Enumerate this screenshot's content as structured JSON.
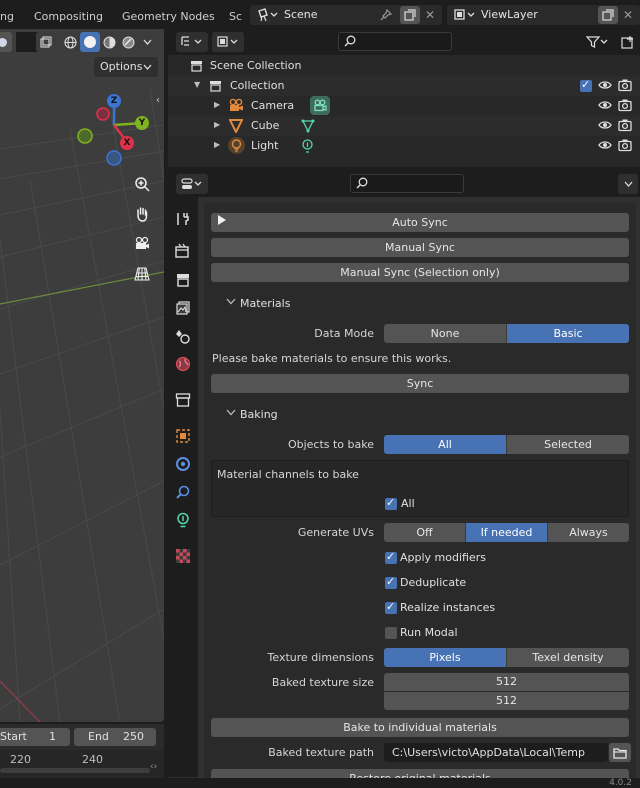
{
  "topbar": {
    "workspace_tabs": [
      "ng",
      "Compositing",
      "Geometry Nodes",
      "Sc"
    ],
    "scene_name": "Scene",
    "view_layer_name": "ViewLayer"
  },
  "viewport": {
    "options_label": "Options",
    "gizmo": {
      "z": "Z",
      "y": "Y",
      "x": "X"
    }
  },
  "timeline": {
    "start_label": "Start",
    "start_value": "1",
    "end_label": "End",
    "end_value": "250",
    "ruler": [
      "220",
      "240"
    ]
  },
  "outliner": {
    "root": "Scene Collection",
    "collection": "Collection",
    "items": [
      "Camera",
      "Cube",
      "Light"
    ]
  },
  "props": {
    "auto_sync": "Auto Sync",
    "manual_sync": "Manual Sync",
    "manual_sync_sel": "Manual Sync (Selection only)",
    "materials_header": "Materials",
    "data_mode_label": "Data Mode",
    "data_mode_options": [
      "None",
      "Basic"
    ],
    "data_mode_selected": "Basic",
    "bake_hint": "Please bake materials to ensure this works.",
    "sync": "Sync",
    "baking_header": "Baking",
    "objects_to_bake_label": "Objects to bake",
    "objects_to_bake_options": [
      "All",
      "Selected"
    ],
    "objects_to_bake_selected": "All",
    "channels_label": "Material channels to bake",
    "channels_all": "All",
    "gen_uvs_label": "Generate UVs",
    "gen_uvs_options": [
      "Off",
      "If needed",
      "Always"
    ],
    "gen_uvs_selected": "If needed",
    "apply_modifiers": "Apply modifiers",
    "deduplicate": "Deduplicate",
    "realize_instances": "Realize instances",
    "run_modal": "Run Modal",
    "tex_dim_label": "Texture dimensions",
    "tex_dim_options": [
      "Pixels",
      "Texel density"
    ],
    "tex_dim_selected": "Pixels",
    "baked_size_label": "Baked texture size",
    "baked_size_x": "512",
    "baked_size_y": "512",
    "bake_individual": "Bake to individual materials",
    "baked_path_label": "Baked texture path",
    "baked_path_value": "C:\\Users\\victo\\AppData\\Local\\Temp",
    "restore_materials": "Restore original materials"
  },
  "statusbar": {
    "version": "4.0.2"
  },
  "colors": {
    "accent": "#4772b3",
    "panel": "#2a2a2a",
    "button": "#545454",
    "viewport": "#3d3d3d"
  }
}
